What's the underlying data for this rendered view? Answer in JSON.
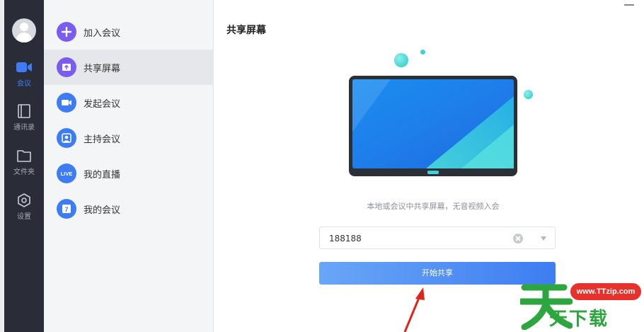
{
  "rail": {
    "items": [
      {
        "label": "会议",
        "icon": "video-camera-icon",
        "active": true
      },
      {
        "label": "通讯录",
        "icon": "contacts-book-icon",
        "active": false
      },
      {
        "label": "文件夹",
        "icon": "folder-icon",
        "active": false
      },
      {
        "label": "设置",
        "icon": "settings-hexagon-icon",
        "active": false
      }
    ]
  },
  "menu": {
    "items": [
      {
        "label": "加入会议",
        "icon": "plus-icon",
        "color": "#7b5cf0"
      },
      {
        "label": "共享屏幕",
        "icon": "share-screen-icon",
        "color": "#7b5cf0"
      },
      {
        "label": "发起会议",
        "icon": "video-icon",
        "color": "#3d7cf4"
      },
      {
        "label": "主持会议",
        "icon": "host-user-icon",
        "color": "#3d7cf4"
      },
      {
        "label": "我的直播",
        "icon": "live-icon",
        "badge": "LIVE",
        "color": "#3d7cf4"
      },
      {
        "label": "我的会议",
        "icon": "calendar-icon",
        "badge": "7",
        "color": "#3d7cf4"
      }
    ]
  },
  "main": {
    "title": "共享屏幕",
    "hint": "本地或会议中共享屏幕，无音视频入会",
    "share_code": {
      "value": "188188"
    },
    "start_button": "开始共享"
  },
  "watermark": {
    "site": "www.TTzip.com",
    "text": "天下载"
  },
  "colors": {
    "rail_bg": "#2a2d38",
    "accent": "#3d7cf4",
    "purple": "#7b5cf0"
  }
}
